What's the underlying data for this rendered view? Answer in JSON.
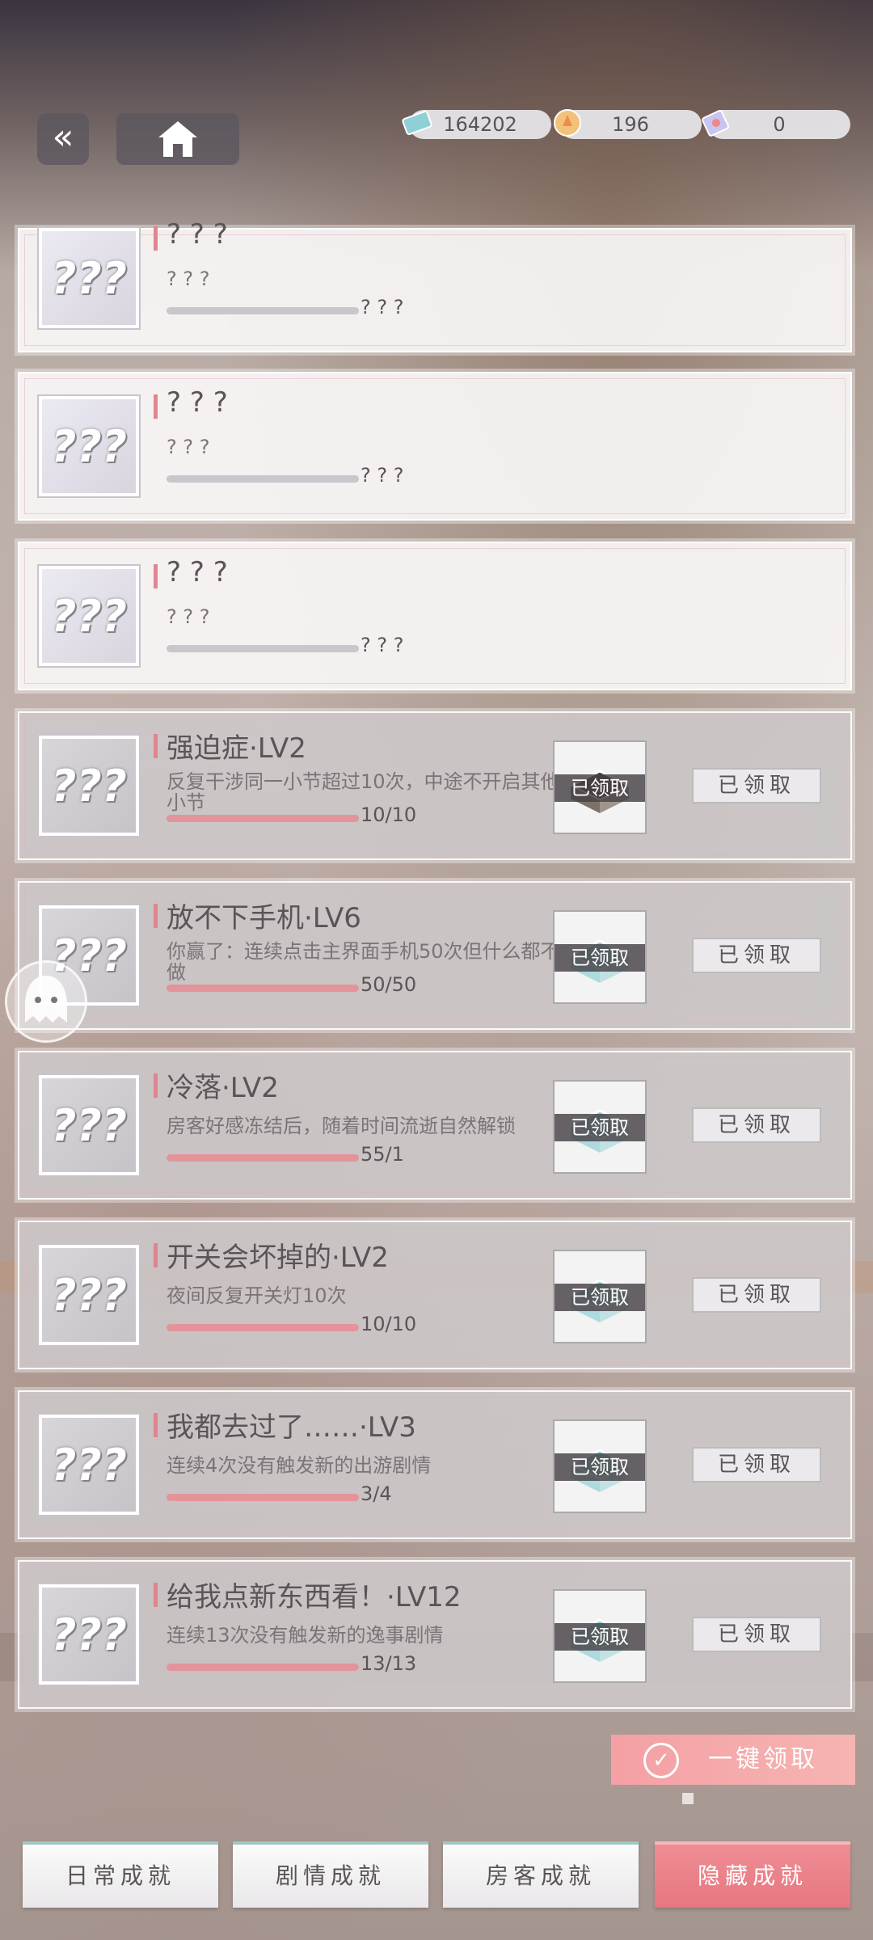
{
  "currencies": [
    {
      "icon": "cash-icon",
      "value": "164202"
    },
    {
      "icon": "gem-icon",
      "value": "196"
    },
    {
      "icon": "ticket-icon",
      "value": "0"
    }
  ],
  "cards": [
    {
      "title": "? ? ?",
      "desc": "? ? ?",
      "progress": "? ? ?",
      "fill": 1.0,
      "locked": true
    },
    {
      "title": "? ? ?",
      "desc": "? ? ?",
      "progress": "? ? ?",
      "fill": 1.0,
      "locked": true
    },
    {
      "title": "? ? ?",
      "desc": "? ? ?",
      "progress": "? ? ?",
      "fill": 1.0,
      "locked": true
    },
    {
      "title": "强迫症·LV2",
      "desc": "反复干涉同一小节超过10次，中途不开启其他小节",
      "progress": "10/10",
      "fill": 1.0,
      "reward_tag": "已领取",
      "claim": "已领取"
    },
    {
      "title": "放不下手机·LV6",
      "desc": "你赢了：连续点击主界面手机50次但什么都不做",
      "progress": "50/50",
      "fill": 1.0,
      "reward_tag": "已领取",
      "claim": "已领取"
    },
    {
      "title": "冷落·LV2",
      "desc": "房客好感冻结后，随着时间流逝自然解锁",
      "progress": "55/1",
      "fill": 1.0,
      "reward_tag": "已领取",
      "claim": "已领取"
    },
    {
      "title": "开关会坏掉的·LV2",
      "desc": "夜间反复开关灯10次",
      "progress": "10/10",
      "fill": 1.0,
      "reward_tag": "已领取",
      "claim": "已领取"
    },
    {
      "title": "我都去过了……·LV3",
      "desc": "连续4次没有触发新的出游剧情",
      "progress": "3/4",
      "fill": 1.0,
      "reward_tag": "已领取",
      "claim": "已领取"
    },
    {
      "title": "给我点新东西看！·LV12",
      "desc": "连续13次没有触发新的逸事剧情",
      "progress": "13/13",
      "fill": 1.0,
      "reward_tag": "已领取",
      "claim": "已领取"
    }
  ],
  "claim_all": "一键领取",
  "tabs": [
    "日常成就",
    "剧情成就",
    "房客成就",
    "隐藏成就"
  ],
  "active_tab": "隐藏成就",
  "placeholder_icon_text": "???"
}
